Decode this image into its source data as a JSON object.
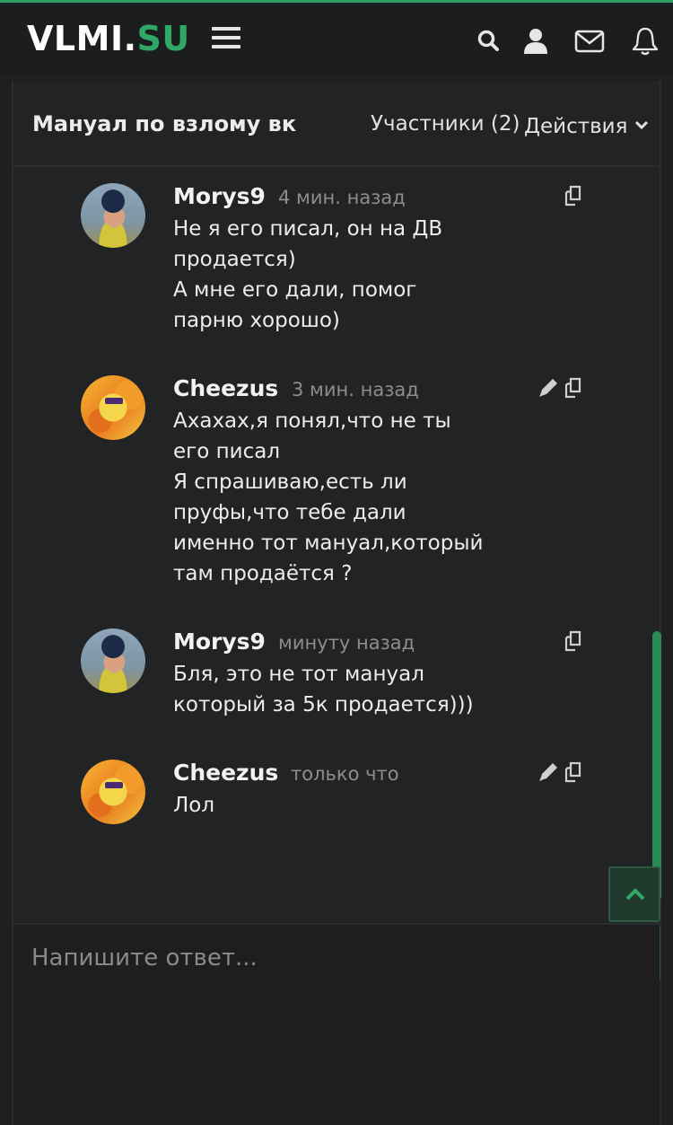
{
  "header": {
    "logo_main": "VLMI.",
    "logo_accent": "SU",
    "icons": [
      "menu-icon",
      "search-icon",
      "user-icon",
      "mail-icon",
      "bell-icon"
    ]
  },
  "conversation": {
    "title": "Мануал по взлому вк",
    "participants_label": "Участники (2)",
    "actions_label": "Действия"
  },
  "messages": [
    {
      "author": "Morys9",
      "time": "4 мин. назад",
      "text": "Не я его писал, он на ДВ\nпродается)\nА мне его дали, помог\nпарню хорошо)",
      "avatar": "avatar-girl",
      "editable": false
    },
    {
      "author": "Cheezus",
      "time": "3 мин. назад",
      "text": "Ахахах,я понял,что не ты\nего писал\nЯ спрашиваю,есть ли\nпруфы,что тебе дали\nименно тот мануал,который\nтам продаётся ?",
      "avatar": "avatar-cheese",
      "editable": true
    },
    {
      "author": "Morys9",
      "time": "минуту назад",
      "text": "Бля, это не тот мануал\nкоторый за 5к продается)))",
      "avatar": "avatar-girl",
      "editable": false
    },
    {
      "author": "Cheezus",
      "time": "только что",
      "text": "Лол",
      "avatar": "avatar-cheese",
      "editable": true
    }
  ],
  "reply": {
    "placeholder": "Напишите ответ..."
  },
  "colors": {
    "accent": "#2fa866",
    "background": "#1e1f20",
    "panel": "#222324"
  }
}
